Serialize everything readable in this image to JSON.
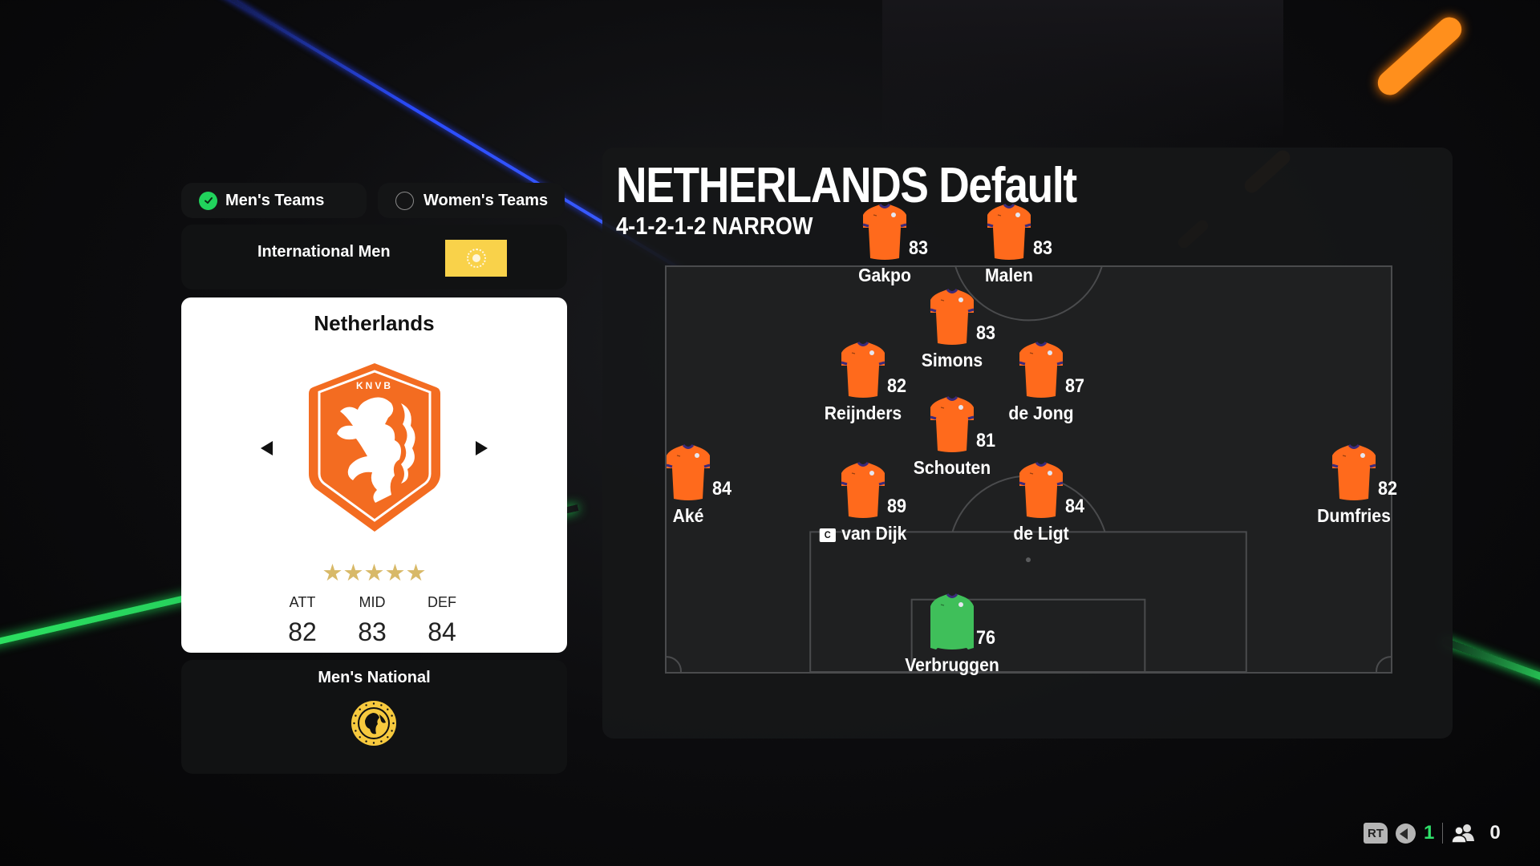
{
  "tabs": [
    {
      "label": "Men's Teams",
      "selected": true
    },
    {
      "label": "Women's Teams",
      "selected": false
    }
  ],
  "league_filter": {
    "label": "International Men",
    "flag_icon": "international-globe-icon",
    "flag_color": "#f9d24a"
  },
  "team_card": {
    "name": "Netherlands",
    "crest_icon": "knvb-lion-crest-icon",
    "crest_text": "KNVB",
    "crest_color": "#f36c21",
    "star_rating": 5,
    "stars": "★★★★★",
    "stats": [
      {
        "label": "ATT",
        "value": "82"
      },
      {
        "label": "MID",
        "value": "83"
      },
      {
        "label": "DEF",
        "value": "84"
      }
    ],
    "prev_icon": "arrow-left-icon",
    "next_icon": "arrow-right-icon"
  },
  "league_panel": {
    "label": "Men's National",
    "badge_icon": "mens-national-globe-badge-icon",
    "badge_color": "#f7c93e"
  },
  "squad": {
    "title": "NETHERLANDS Default",
    "formation": "4-1-2-1-2 NARROW",
    "kit_color": "#ff6a1c",
    "gk_kit_color": "#3fbf5a",
    "captain_marker": "C",
    "players": [
      {
        "name": "Gakpo",
        "rating": "83",
        "role": "ST",
        "gk": false,
        "captain": false
      },
      {
        "name": "Malen",
        "rating": "83",
        "role": "ST",
        "gk": false,
        "captain": false
      },
      {
        "name": "Simons",
        "rating": "83",
        "role": "CAM",
        "gk": false,
        "captain": false
      },
      {
        "name": "Reijnders",
        "rating": "82",
        "role": "CM",
        "gk": false,
        "captain": false
      },
      {
        "name": "de Jong",
        "rating": "87",
        "role": "CM",
        "gk": false,
        "captain": false
      },
      {
        "name": "Schouten",
        "rating": "81",
        "role": "CDM",
        "gk": false,
        "captain": false
      },
      {
        "name": "Aké",
        "rating": "84",
        "role": "LB",
        "gk": false,
        "captain": false
      },
      {
        "name": "van Dijk",
        "rating": "89",
        "role": "CB",
        "gk": false,
        "captain": true
      },
      {
        "name": "de Ligt",
        "rating": "84",
        "role": "CB",
        "gk": false,
        "captain": false
      },
      {
        "name": "Dumfries",
        "rating": "82",
        "role": "RB",
        "gk": false,
        "captain": false
      },
      {
        "name": "Verbruggen",
        "rating": "76",
        "role": "GK",
        "gk": true,
        "captain": false
      }
    ]
  },
  "hud": {
    "rt_label": "RT",
    "voice_count": "1",
    "party_count": "0"
  }
}
